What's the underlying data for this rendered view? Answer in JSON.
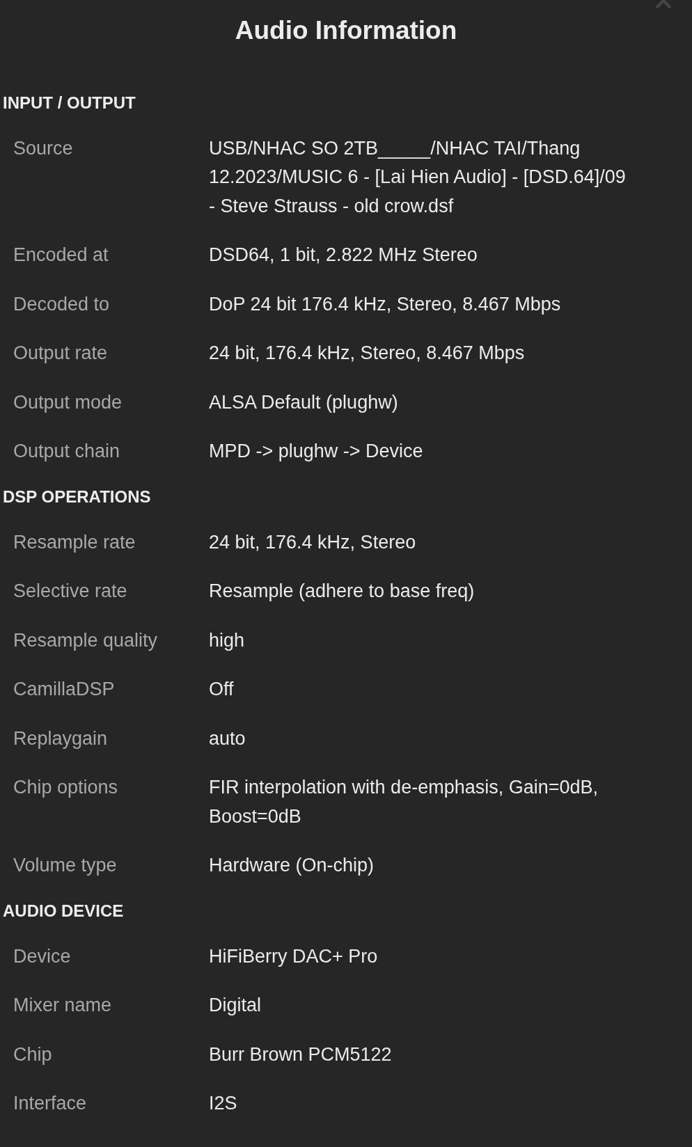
{
  "title": "Audio Information",
  "sections": [
    {
      "heading": "INPUT / OUTPUT",
      "rows": [
        {
          "label": "Source",
          "value": "USB/NHAC SO 2TB_____/NHAC TAI/Thang 12.2023/MUSIC 6 - [Lai Hien Audio] - [DSD.64]/09 - Steve Strauss - old crow.dsf"
        },
        {
          "label": "Encoded at",
          "value": "DSD64, 1 bit, 2.822 MHz Stereo"
        },
        {
          "label": "Decoded to",
          "value": "DoP 24 bit 176.4 kHz, Stereo, 8.467 Mbps"
        },
        {
          "label": "Output rate",
          "value": "24 bit, 176.4 kHz, Stereo, 8.467 Mbps"
        },
        {
          "label": "Output mode",
          "value": "ALSA Default (plughw)"
        },
        {
          "label": "Output chain",
          "value": "MPD -> plughw -> Device"
        }
      ]
    },
    {
      "heading": "DSP OPERATIONS",
      "rows": [
        {
          "label": "Resample rate",
          "value": "24 bit, 176.4 kHz, Stereo"
        },
        {
          "label": "Selective rate",
          "value": "Resample (adhere to base freq)"
        },
        {
          "label": "Resample quality",
          "value": "high"
        },
        {
          "label": "CamillaDSP",
          "value": "Off"
        },
        {
          "label": "Replaygain",
          "value": "auto"
        },
        {
          "label": "Chip options",
          "value": "FIR interpolation with de-emphasis, Gain=0dB, Boost=0dB"
        },
        {
          "label": "Volume type",
          "value": "Hardware (On-chip)"
        }
      ]
    },
    {
      "heading": "AUDIO DEVICE",
      "rows": [
        {
          "label": "Device",
          "value": "HiFiBerry DAC+ Pro"
        },
        {
          "label": "Mixer name",
          "value": "Digital"
        },
        {
          "label": "Chip",
          "value": "Burr Brown PCM5122"
        },
        {
          "label": "Interface",
          "value": "I2S"
        }
      ]
    }
  ]
}
